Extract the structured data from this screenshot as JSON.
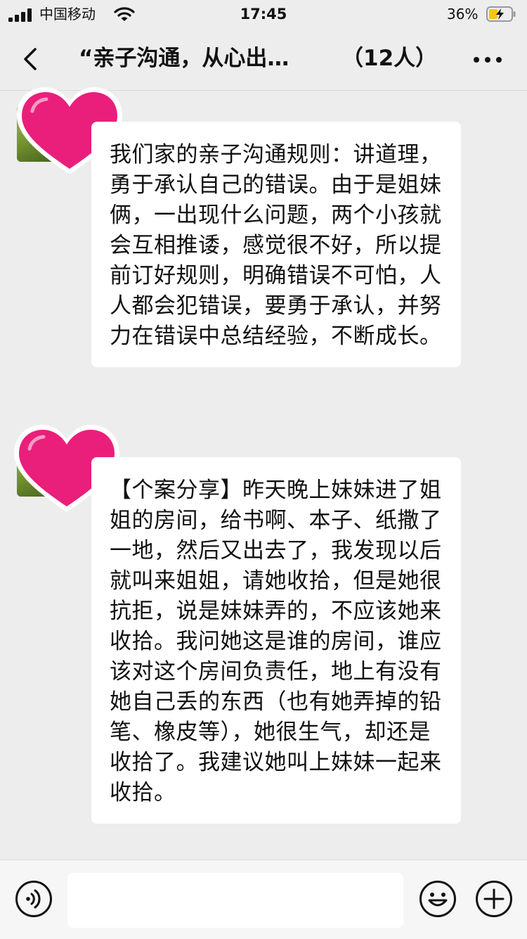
{
  "status_bar": {
    "carrier": "中国移动",
    "time": "17:45",
    "battery_percent": "36%"
  },
  "nav": {
    "title": "“亲子沟通，从心出…",
    "member_count": "（12人）"
  },
  "messages": [
    {
      "text": "我们家的亲子沟通规则：讲道理，勇于承认自己的错误。由于是姐妹俩，一出现什么问题，两个小孩就会互相推诿，感觉很不好，所以提前订好规则，明确错误不可怕，人人都会犯错误，要勇于承认，并努力在错误中总结经验，不断成长。"
    },
    {
      "text": "【个案分享】昨天晚上妹妹进了姐姐的房间，给书啊、本子、纸撒了一地，然后又出去了，我发现以后就叫来姐姐，请她收拾，但是她很抗拒，说是妹妹弄的，不应该她来收拾。我问她这是谁的房间，谁应该对这个房间负责任，地上有没有她自己丢的东西（也有她弄掉的铅笔、橡皮等），她很生气，却还是收拾了。我建议她叫上妹妹一起来收拾。"
    }
  ],
  "input": {
    "placeholder": ""
  },
  "colors": {
    "background": "#ededed",
    "bubble": "#ffffff",
    "heart": "#ea1f7b",
    "battery_fill": "#f5c518"
  },
  "icons": [
    "signal-icon",
    "wifi-icon",
    "battery-charging-icon",
    "back-chevron-icon",
    "more-dots-icon",
    "heart-sticker-icon",
    "voice-icon",
    "emoji-icon",
    "plus-icon"
  ]
}
